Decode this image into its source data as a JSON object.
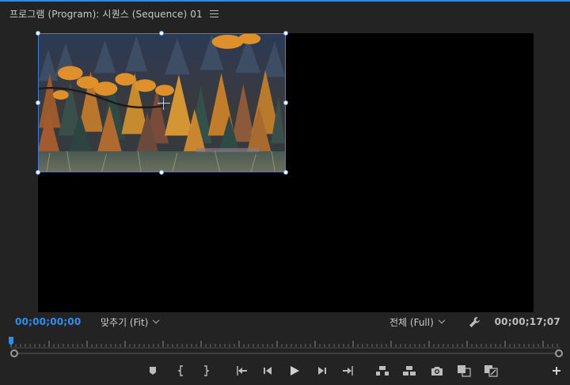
{
  "panel": {
    "title": "프로그램 (Program): 시퀀스 (Sequence) 01",
    "menu_icon": "hamburger-menu-icon"
  },
  "timecode": {
    "current": "00;00;00;00",
    "duration": "00;00;17;07"
  },
  "zoom": {
    "label": "맞추기 (Fit)"
  },
  "resolution": {
    "label": "전체 (Full)"
  },
  "colors": {
    "accent": "#2f8ef2",
    "panel_bg": "#232323",
    "viewer_bg": "#000000",
    "selection": "#3f7be0"
  },
  "controls": [
    "add-marker-icon",
    "mark-in-icon",
    "mark-out-icon",
    "go-to-in-icon",
    "step-back-icon",
    "play-icon",
    "step-forward-icon",
    "go-to-out-icon",
    "lift-icon",
    "extract-icon",
    "export-frame-icon",
    "comparison-view-icon",
    "toggle-proxies-icon",
    "button-editor-plus-icon"
  ]
}
